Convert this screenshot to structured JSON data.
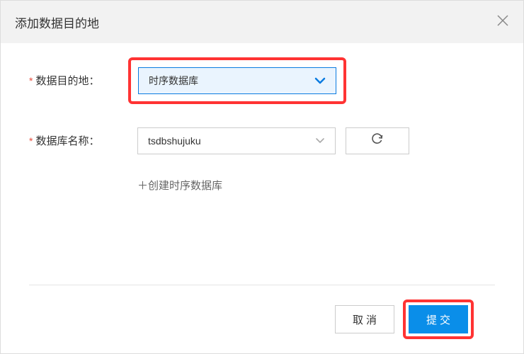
{
  "modal": {
    "title": "添加数据目的地",
    "close_label": "×"
  },
  "form": {
    "destination": {
      "label": "数据目的地：",
      "value": "时序数据库"
    },
    "dbname": {
      "label": "数据库名称：",
      "value": "tsdbshujuku"
    },
    "create_link": "＋创建时序数据库"
  },
  "footer": {
    "cancel": "取消",
    "submit": "提交"
  }
}
